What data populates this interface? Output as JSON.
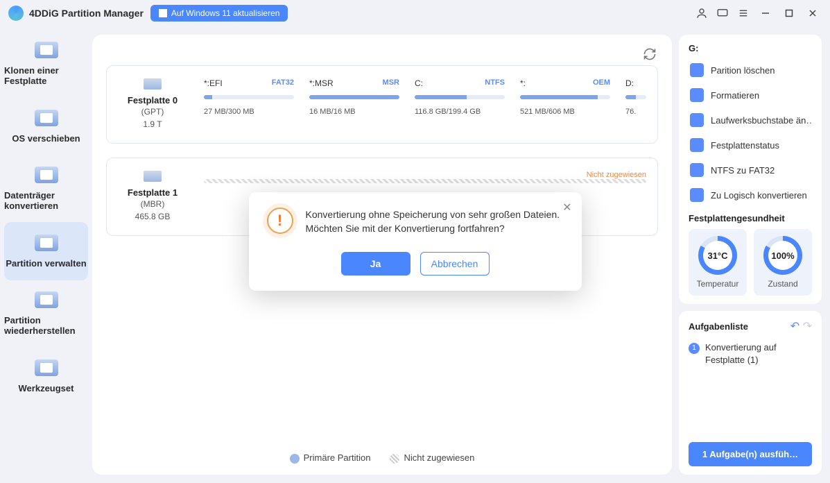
{
  "titlebar": {
    "app_name": "4DDiG Partition Manager",
    "upgrade_label": "Auf Windows 11 aktualisieren"
  },
  "sidebar": [
    {
      "label": "Klonen einer Festplatte"
    },
    {
      "label": "OS verschieben"
    },
    {
      "label": "Datenträger konvertieren"
    },
    {
      "label": "Partition verwalten"
    },
    {
      "label": "Partition wiederherstellen"
    },
    {
      "label": "Werkzeugset"
    }
  ],
  "disks": [
    {
      "name": "Festplatte 0",
      "scheme": "(GPT)",
      "size": "1.9 T",
      "partitions": [
        {
          "label": "*:EFI",
          "fs": "FAT32",
          "usage": "27 MB/300 MB",
          "fill": 9
        },
        {
          "label": "*:MSR",
          "fs": "MSR",
          "usage": "16 MB/16 MB",
          "fill": 100
        },
        {
          "label": "C:",
          "fs": "NTFS",
          "usage": "116.8 GB/199.4 GB",
          "fill": 58
        },
        {
          "label": "*:",
          "fs": "OEM",
          "usage": "521 MB/606 MB",
          "fill": 86
        },
        {
          "label": "D:",
          "fs": "",
          "usage": "76.",
          "fill": 50
        }
      ]
    },
    {
      "name": "Festplatte 1",
      "scheme": "(MBR)",
      "size": "465.8 GB",
      "partitions": [
        {
          "na_label": "Nicht zugewiesen",
          "unalloc": true
        }
      ]
    }
  ],
  "legend": {
    "primary": "Primäre Partition",
    "unalloc": "Nicht zugewiesen"
  },
  "right": {
    "drive_label": "G:",
    "actions": [
      "Parition löschen",
      "Formatieren",
      "Laufwerksbuchstabe än…",
      "Festplattenstatus",
      "NTFS zu FAT32",
      "Zu Logisch konvertieren"
    ],
    "health_header": "Festplattengesundheit",
    "temperature_value": "31°C",
    "temperature_label": "Temperatur",
    "condition_value": "100%",
    "condition_label": "Zustand",
    "tasks_header": "Aufgabenliste",
    "task1": "Konvertierung auf Festplatte (1)",
    "run_button": "1 Aufgabe(n) ausfüh…"
  },
  "modal": {
    "message": "Konvertierung ohne Speicherung von sehr großen Dateien. Möchten Sie mit der Konvertierung fortfahren?",
    "yes": "Ja",
    "cancel": "Abbrechen"
  }
}
